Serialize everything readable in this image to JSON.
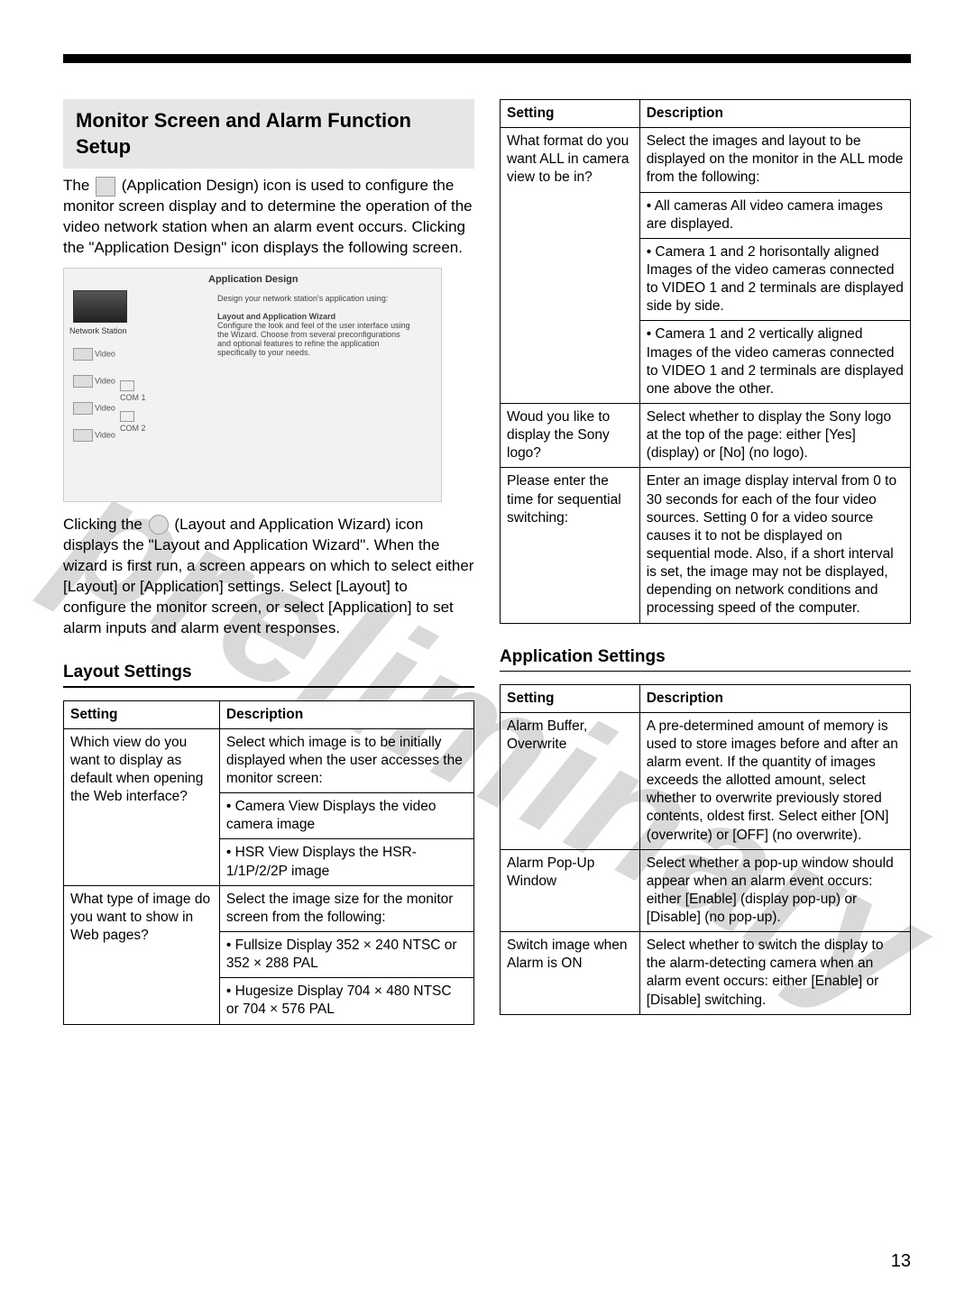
{
  "watermark_text": "preliminary",
  "page_number": "13",
  "top": {
    "section_title": "Monitor Screen and Alarm Function Setup",
    "para1_pre": "The ",
    "para1_icon_name": "(Application Design)",
    "para1_post": " icon is used to configure the monitor screen display and to determine the operation of the video network station when an alarm event occurs. Clicking the \"Application Design\" icon displays the following screen.",
    "shot": {
      "title": "Application Design",
      "intro": "Design your network station's application using:",
      "wizard_title": "Layout and Application Wizard",
      "wizard_desc": "Configure the look and feel of the user interface using the Wizard. Choose from several preconfigurations and optional features to refine the application specifically to your needs.",
      "ns_label": "Network Station",
      "video": "Video",
      "com1": "COM 1",
      "com2": "COM 2"
    },
    "para2_pre": "Clicking the ",
    "para2_icon_name": "(Layout and Application Wizard)",
    "para2_post": " icon displays the \"Layout and Application Wizard\". When the wizard is first run, a screen appears on which to select either [Layout] or [Application] settings. Select [Layout] to configure the monitor screen, or select [Application] to set alarm inputs and alarm event responses."
  },
  "layout": {
    "heading": "Layout Settings",
    "header_setting": "Setting",
    "header_desc": "Description",
    "r1": {
      "setting": "Which view do you want to display as default when opening the Web interface?",
      "desc_top": "Select which image is to be initially displayed when the user accesses the monitor screen:",
      "b1_title": "• Camera View",
      "b1_desc": "Displays the video camera image",
      "b2_title": "• HSR View",
      "b2_desc": "Displays the HSR-1/1P/2/2P image"
    },
    "r2": {
      "setting": "What type of image do you want to show in Web pages?",
      "desc_top": "Select the image size for the monitor screen from the following:",
      "b1_title": "• Fullsize",
      "b1_desc": "Display 352 × 240 NTSC or 352 × 288 PAL",
      "b2_title": "• Hugesize",
      "b2_desc": "Display 704 × 480 NTSC or 704 × 576 PAL"
    }
  },
  "right_top": {
    "header_setting": "Setting",
    "header_desc": "Description",
    "r1": {
      "setting": "What format do you want ALL in camera view to be in?",
      "desc_top": "Select the images and layout to be displayed on the monitor in the ALL mode from the following:",
      "b1_title": "• All cameras",
      "b1_desc": "All video camera images are displayed.",
      "b2_title": "• Camera 1 and 2 horisontally aligned",
      "b2_desc": "Images of the video cameras connected to VIDEO 1 and 2 terminals are displayed side by side.",
      "b3_title": "• Camera 1 and 2 vertically aligned",
      "b3_desc": "Images of the video cameras connected to VIDEO 1 and 2 terminals are displayed one above the other."
    },
    "r2": {
      "setting": "Woud you like to display the Sony logo?",
      "desc": "Select whether to display the Sony logo at the top of the page: either [Yes] (display) or [No] (no logo)."
    },
    "r3": {
      "setting": "Please enter the time for sequential switching:",
      "desc": "Enter an image display interval from 0 to 30 seconds for each of the four video sources. Setting 0 for a video source causes it to not be displayed on sequential mode. Also, if a short interval is set, the image may not be displayed, depending on network conditions and processing speed of the computer."
    }
  },
  "app": {
    "heading": "Application Settings",
    "header_setting": "Setting",
    "header_desc": "Description",
    "r1": {
      "setting": "Alarm Buffer, Overwrite",
      "desc": "A pre-determined amount of memory is used to store images before and after an alarm event. If the quantity of images exceeds the allotted amount, select whether to overwrite previously stored contents, oldest first. Select either [ON] (overwrite) or [OFF] (no overwrite)."
    },
    "r2": {
      "setting": "Alarm Pop-Up Window",
      "desc": "Select whether a pop-up window should appear when an alarm event occurs: either [Enable] (display pop-up) or [Disable] (no pop-up)."
    },
    "r3": {
      "setting": "Switch image when Alarm is ON",
      "desc": "Select whether to switch the display to the alarm-detecting camera when an alarm event occurs: either [Enable] or [Disable] switching."
    }
  }
}
